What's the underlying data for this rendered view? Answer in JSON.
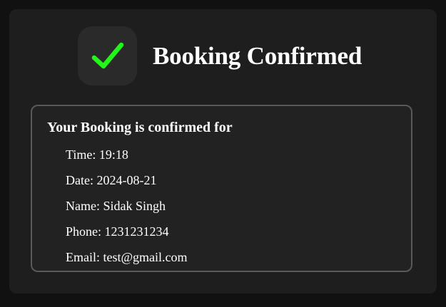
{
  "header": {
    "icon": "checkmark-icon",
    "title": "Booking Confirmed",
    "check_color": "#22f51a"
  },
  "details": {
    "heading": "Your Booking is confirmed for",
    "rows": [
      {
        "label": "Time",
        "value": "19:18",
        "text": "Time: 19:18"
      },
      {
        "label": "Date",
        "value": "2024-08-21",
        "text": "Date: 2024-08-21"
      },
      {
        "label": "Name",
        "value": "Sidak Singh",
        "text": "Name: Sidak Singh"
      },
      {
        "label": "Phone",
        "value": "1231231234",
        "text": "Phone: 1231231234"
      },
      {
        "label": "Email",
        "value": "test@gmail.com",
        "text": "Email: test@gmail.com"
      }
    ]
  }
}
